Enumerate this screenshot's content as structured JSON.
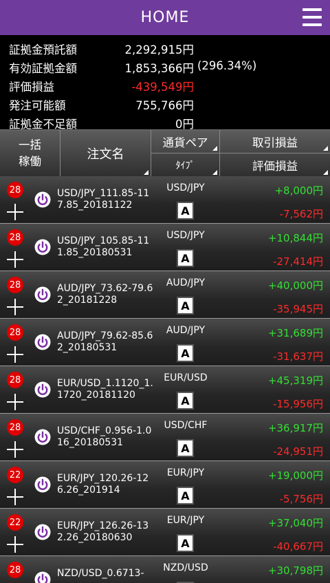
{
  "header": {
    "title": "HOME"
  },
  "summary": {
    "deposit": {
      "label": "証拠金預託額",
      "value": "2,292,915円"
    },
    "effective": {
      "label": "有効証拠金額",
      "value": "1,853,366円",
      "ratio": "(296.34%)"
    },
    "unrealized": {
      "label": "評価損益",
      "value": "-439,549円"
    },
    "available": {
      "label": "発注可能額",
      "value": "755,766円"
    },
    "shortage": {
      "label": "証拠金不足額",
      "value": "0円"
    }
  },
  "table_header": {
    "bulk_line1": "一括",
    "bulk_line2": "稼働",
    "order_name": "注文名",
    "pair": "通貨ペア",
    "type": "ﾀｲﾌﾟ",
    "realized": "取引損益",
    "unrealized": "評価損益"
  },
  "orders": [
    {
      "count": "28",
      "name": "USD/JPY_111.85-117.85_20181122",
      "pair": "USD/JPY",
      "type": "A",
      "realized": "+8,000円",
      "unrealized": "-7,562円"
    },
    {
      "count": "28",
      "name": "USD/JPY_105.85-111.85_20180531",
      "pair": "USD/JPY",
      "type": "A",
      "realized": "+10,844円",
      "unrealized": "-27,414円"
    },
    {
      "count": "28",
      "name": "AUD/JPY_73.62-79.62_20181228",
      "pair": "AUD/JPY",
      "type": "A",
      "realized": "+40,000円",
      "unrealized": "-35,945円"
    },
    {
      "count": "28",
      "name": "AUD/JPY_79.62-85.62_20180531",
      "pair": "AUD/JPY",
      "type": "A",
      "realized": "+31,689円",
      "unrealized": "-31,637円"
    },
    {
      "count": "28",
      "name": "EUR/USD_1.1120_1.1720_20181120",
      "pair": "EUR/USD",
      "type": "A",
      "realized": "+45,319円",
      "unrealized": "-15,956円"
    },
    {
      "count": "28",
      "name": "USD/CHF_0.956-1.016_20180531",
      "pair": "USD/CHF",
      "type": "A",
      "realized": "+36,917円",
      "unrealized": "-24,951円"
    },
    {
      "count": "22",
      "name": "EUR/JPY_120.26-126.26_201914",
      "pair": "EUR/JPY",
      "type": "A",
      "realized": "+19,000円",
      "unrealized": "-5,756円"
    },
    {
      "count": "22",
      "name": "EUR/JPY_126.26-132.26_20180630",
      "pair": "EUR/JPY",
      "type": "A",
      "realized": "+37,040円",
      "unrealized": "-40,667円"
    },
    {
      "count": "28",
      "name": "NZD/USD_0.6713-",
      "pair": "NZD/USD",
      "type": "A",
      "realized": "+30,798円",
      "unrealized": ""
    }
  ]
}
